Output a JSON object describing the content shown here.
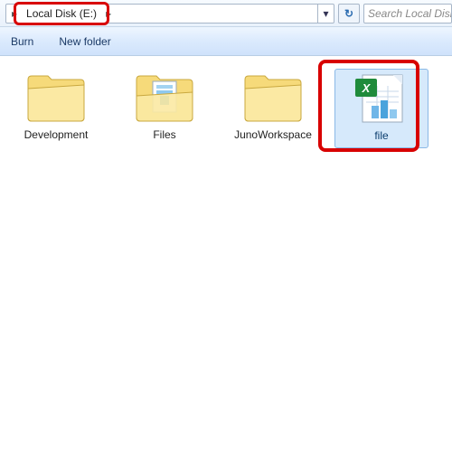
{
  "address": {
    "crumb": "Local Disk (E:)",
    "search_placeholder": "Search Local Disk (E:)"
  },
  "toolbar": {
    "burn": "Burn",
    "newfolder": "New folder"
  },
  "items": [
    {
      "label": "Development",
      "type": "folder"
    },
    {
      "label": "Files",
      "type": "folder"
    },
    {
      "label": "JunoWorkspace",
      "type": "folder"
    },
    {
      "label": "file",
      "type": "excel",
      "selected": true
    }
  ]
}
